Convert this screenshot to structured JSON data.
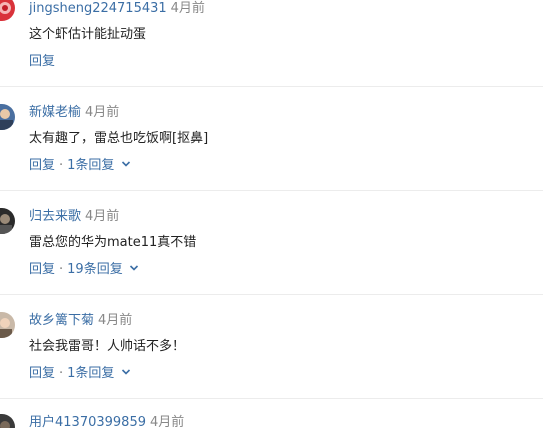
{
  "comments": [
    {
      "username": "jingsheng224715431",
      "time": "4月前",
      "content": "这个虾估计能扯动蛋",
      "reply_label": "回复",
      "replies_label": ""
    },
    {
      "username": "新媒老榆",
      "time": "4月前",
      "content": "太有趣了，雷总也吃饭啊[抠鼻]",
      "reply_label": "回复",
      "separator": "·",
      "replies_label": "1条回复"
    },
    {
      "username": "归去来歌",
      "time": "4月前",
      "content": "雷总您的华为mate11真不错",
      "reply_label": "回复",
      "separator": "·",
      "replies_label": "19条回复"
    },
    {
      "username": "故乡篱下菊",
      "time": "4月前",
      "content": "社会我雷哥！人帅话不多！",
      "reply_label": "回复",
      "separator": "·",
      "replies_label": "1条回复"
    },
    {
      "username": "用户41370399859",
      "time": "4月前"
    }
  ],
  "colors": {
    "link": "#3b6ea5",
    "text": "#222222",
    "time": "#888888",
    "divider": "#ececec"
  }
}
